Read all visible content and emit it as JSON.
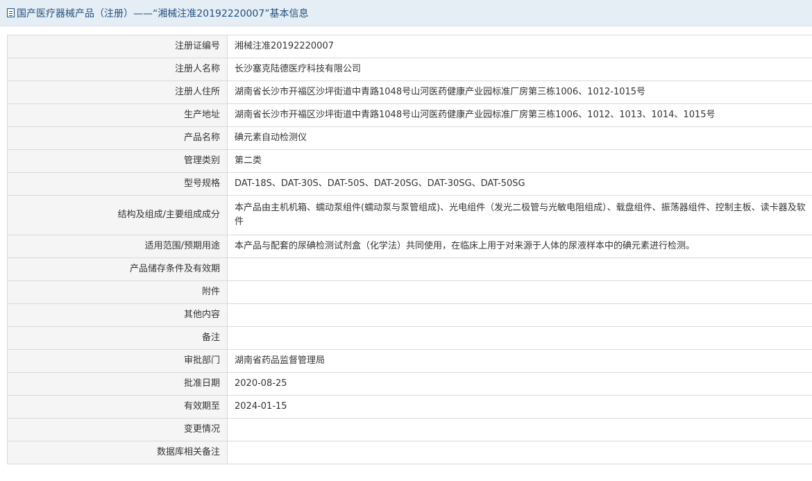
{
  "header": {
    "icon": "document-icon",
    "title": "国产医疗器械产品（注册）——“湘械注准20192220007”基本信息"
  },
  "rows": [
    {
      "label": "注册证编号",
      "value": "湘械注准20192220007"
    },
    {
      "label": "注册人名称",
      "value": "长沙塞克陆德医疗科技有限公司"
    },
    {
      "label": "注册人住所",
      "value": "湖南省长沙市开福区沙坪街道中青路1048号山河医药健康产业园标准厂房第三栋1006、1012-1015号"
    },
    {
      "label": "生产地址",
      "value": "湖南省长沙市开福区沙坪街道中青路1048号山河医药健康产业园标准厂房第三栋1006、1012、1013、1014、1015号"
    },
    {
      "label": "产品名称",
      "value": "碘元素自动检测仪"
    },
    {
      "label": "管理类别",
      "value": "第二类"
    },
    {
      "label": "型号规格",
      "value": "DAT-18S、DAT-30S、DAT-50S、DAT-20SG、DAT-30SG、DAT-50SG"
    },
    {
      "label": "结构及组成/主要组成成分",
      "value": "本产品由主机机箱、蠕动泵组件(蠕动泵与泵管组成)、光电组件（发光二极管与光敏电阻组成）、载盘组件、振荡器组件、控制主板、读卡器及软件"
    },
    {
      "label": "适用范围/预期用途",
      "value": "本产品与配套的尿碘检测试剂盒（化学法）共同使用，在临床上用于对来源于人体的尿液样本中的碘元素进行检测。"
    },
    {
      "label": "产品储存条件及有效期",
      "value": ""
    },
    {
      "label": "附件",
      "value": ""
    },
    {
      "label": "其他内容",
      "value": ""
    },
    {
      "label": "备注",
      "value": ""
    },
    {
      "label": "审批部门",
      "value": "湖南省药品监督管理局"
    },
    {
      "label": "批准日期",
      "value": "2020-08-25"
    },
    {
      "label": "有效期至",
      "value": "2024-01-15"
    },
    {
      "label": "变更情况",
      "value": ""
    },
    {
      "label": "数据库相关备注",
      "value": ""
    }
  ]
}
